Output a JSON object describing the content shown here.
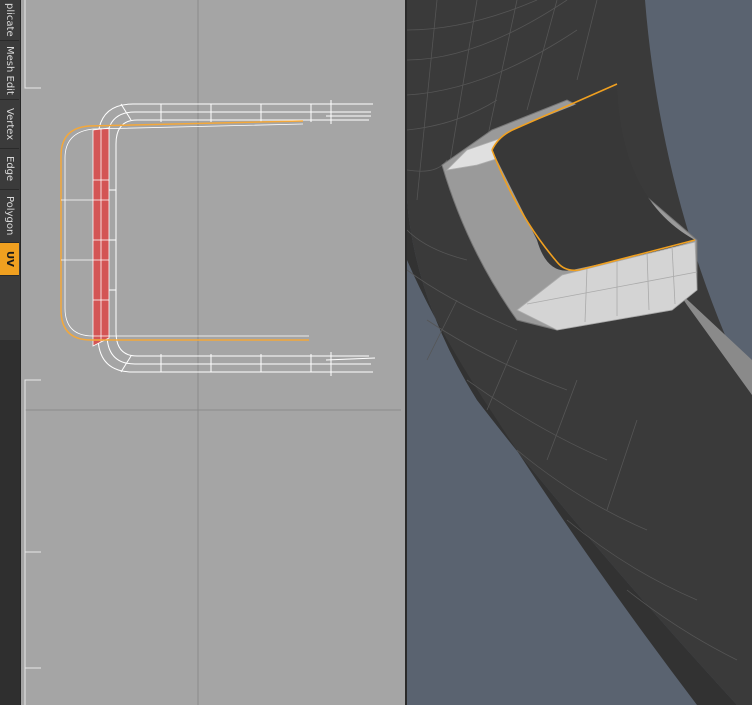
{
  "toolbar": {
    "tabs": [
      {
        "label": "plicate",
        "active": false
      },
      {
        "label": "Mesh Edit",
        "active": false
      },
      {
        "label": "Vertex",
        "active": false
      },
      {
        "label": "Edge",
        "active": false
      },
      {
        "label": "Polygon",
        "active": false
      },
      {
        "label": "UV",
        "active": true
      }
    ],
    "accent_color": "#f0a020"
  },
  "colors": {
    "uv_background": "#a5a5a5",
    "uv_wire": "#ffffff",
    "uv_selection": "#e05050",
    "edge_highlight": "#f0a020",
    "perspective_background": "#5a6370",
    "mesh_dark": "#3a3a3a"
  }
}
